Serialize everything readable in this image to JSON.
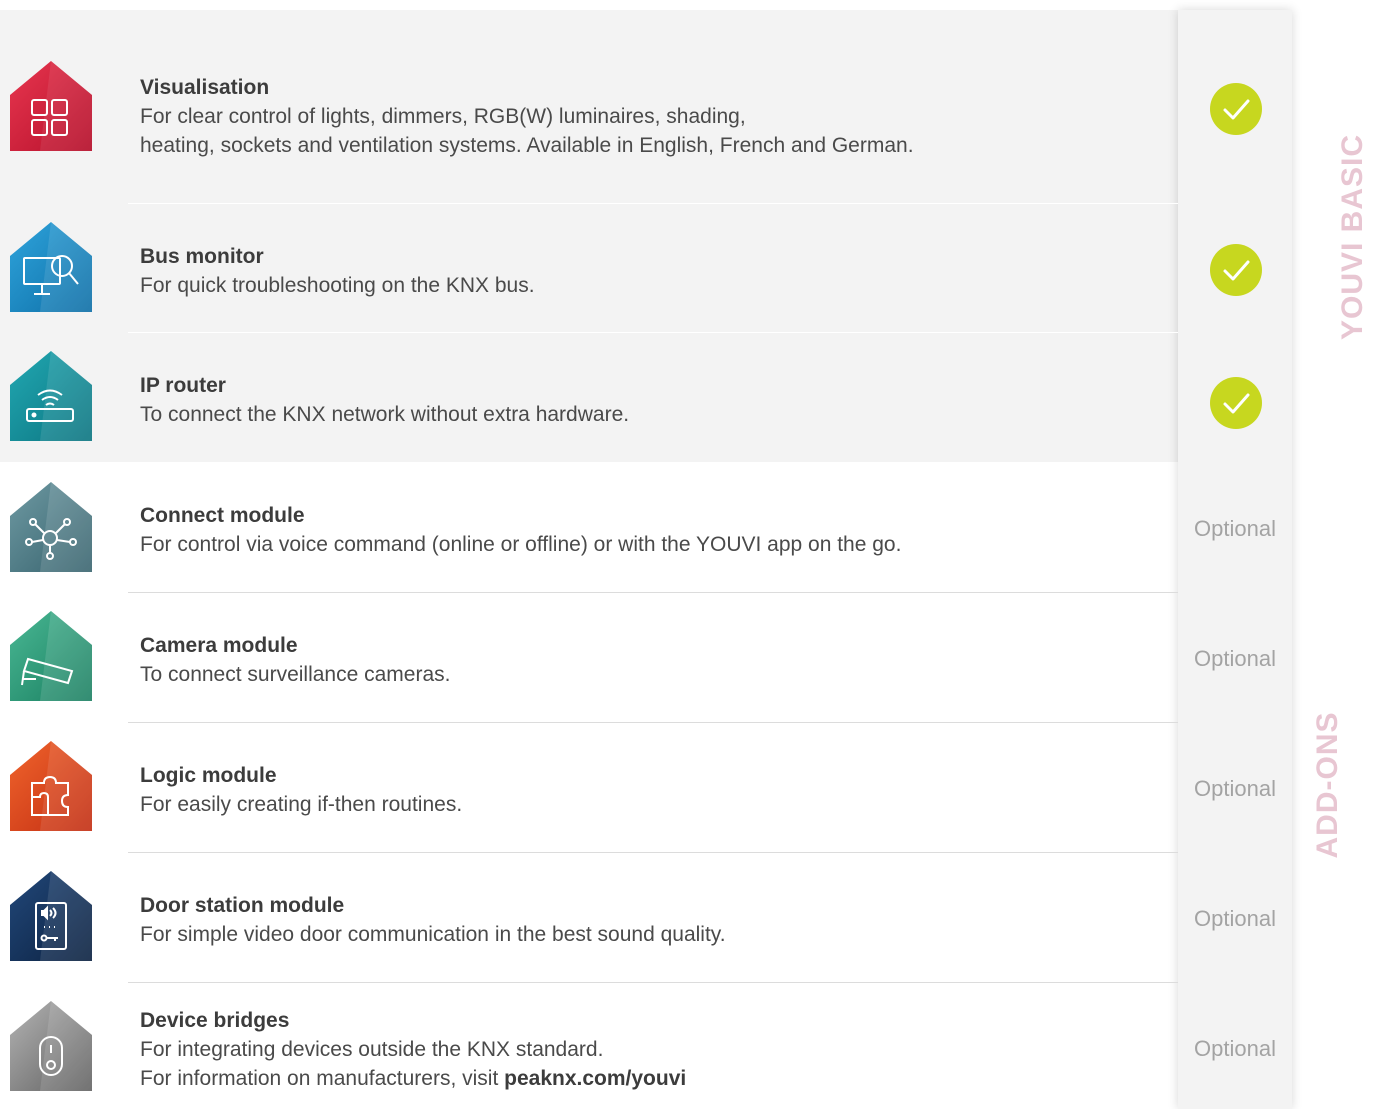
{
  "side_labels": {
    "basic": "YOUVI BASIC",
    "addons": "ADD-ONS"
  },
  "rows": [
    {
      "title": "Visualisation",
      "desc1": "For clear control of lights, dimmers, RGB(W) luminaires, shading,",
      "desc2": "heating, sockets and ventilation systems. Available in English, French and German.",
      "icon": "grid-icon",
      "color": "#d81e3c",
      "status": "check"
    },
    {
      "title": "Bus monitor",
      "desc1": "For quick troubleshooting on the KNX bus.",
      "icon": "monitor-search-icon",
      "color": "#1a8ec8",
      "status": "check"
    },
    {
      "title": "IP router",
      "desc1": "To connect the KNX network without extra hardware.",
      "icon": "router-icon",
      "color": "#138f9b",
      "status": "check"
    },
    {
      "title": "Connect module",
      "desc1": "For control via voice command (online or offline) or with the YOUVI app on the go.",
      "icon": "network-nodes-icon",
      "color": "#4d7a85",
      "status": "Optional"
    },
    {
      "title": "Camera module",
      "desc1": "To connect surveillance cameras.",
      "icon": "camera-icon",
      "color": "#2a9b7a",
      "status": "Optional"
    },
    {
      "title": "Logic module",
      "desc1": "For easily creating if-then routines.",
      "icon": "puzzle-icon",
      "color": "#e14a1f",
      "status": "Optional"
    },
    {
      "title": "Door station module",
      "desc1": "For simple video door communication in the best sound quality.",
      "icon": "door-station-icon",
      "color": "#14345c",
      "status": "Optional"
    },
    {
      "title": "Device bridges",
      "desc1": "For integrating devices outside the KNX standard.",
      "desc2_prefix": "For information on manufacturers, visit ",
      "desc2_link": "peaknx.com/youvi",
      "icon": "doorbell-icon",
      "color": "#8c8c8c",
      "status": "Optional"
    }
  ]
}
